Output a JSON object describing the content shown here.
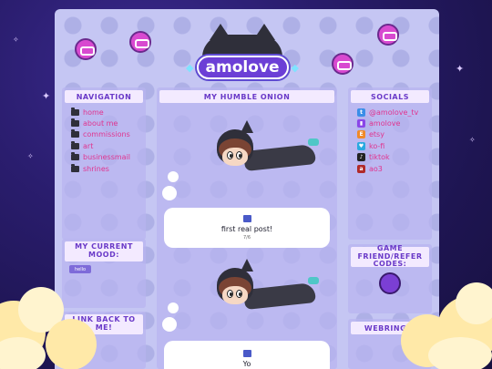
{
  "site": {
    "logo_text": "amolove"
  },
  "navigation": {
    "title": "NAVIGATION",
    "items": [
      {
        "label": "home",
        "icon": "folder-icon"
      },
      {
        "label": "about me",
        "icon": "folder-icon"
      },
      {
        "label": "commissions",
        "icon": "folder-icon"
      },
      {
        "label": "art",
        "icon": "folder-icon"
      },
      {
        "label": "businessmail",
        "icon": "folder-icon"
      },
      {
        "label": "shrines",
        "icon": "folder-icon"
      }
    ]
  },
  "mood": {
    "title": "MY CURRENT MOOD:",
    "badge": "hello"
  },
  "link_back": {
    "title": "LINK BACK TO ME!"
  },
  "main": {
    "title": "MY HUMBLE ONION",
    "posts": [
      {
        "title": "first real post!",
        "date": "7/6"
      },
      {
        "title": "Yo",
        "date": ""
      }
    ]
  },
  "socials": {
    "title": "SOCIALS",
    "items": [
      {
        "label": "@amolove_tv",
        "icon": "twitter-icon",
        "color": "#3b8ee8"
      },
      {
        "label": "amolove",
        "icon": "twitch-icon",
        "color": "#8a46e8"
      },
      {
        "label": "etsy",
        "icon": "etsy-icon",
        "color": "#f08a2a"
      },
      {
        "label": "ko-fi",
        "icon": "kofi-icon",
        "color": "#2aa9e0"
      },
      {
        "label": "tiktok",
        "icon": "tiktok-icon",
        "color": "#222222"
      },
      {
        "label": "ao3",
        "icon": "ao3-icon",
        "color": "#b02a2a"
      }
    ]
  },
  "friends": {
    "title": "GAME FRIEND/REFER CODES:"
  },
  "webrings": {
    "title": "WEBRINGS:"
  },
  "colors": {
    "link": "#e0348f",
    "accent": "#6a3ac8",
    "background": "#2a1d6e"
  }
}
